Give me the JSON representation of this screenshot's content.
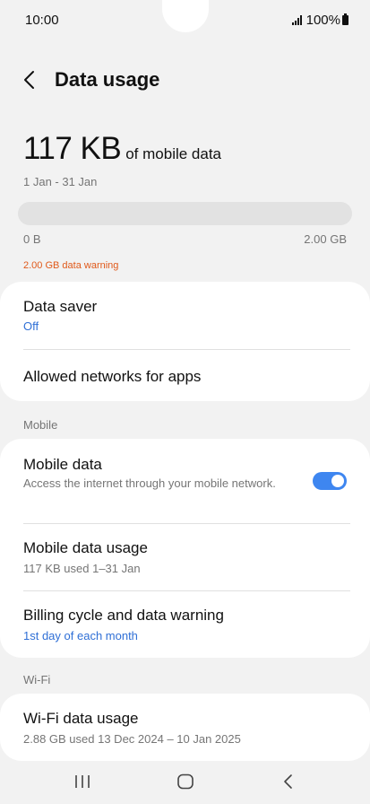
{
  "status_bar": {
    "time": "10:00",
    "battery": "100%"
  },
  "header": {
    "title": "Data usage"
  },
  "summary": {
    "amount": "117 KB",
    "suffix": "of mobile data",
    "period": "1 Jan - 31 Jan",
    "bar_min": "0 B",
    "bar_max": "2.00 GB",
    "bar_fill_fraction": 0.0,
    "warning": "2.00 GB data warning"
  },
  "general": {
    "data_saver_title": "Data saver",
    "data_saver_value": "Off",
    "allowed_networks_title": "Allowed networks for apps"
  },
  "mobile": {
    "section_label": "Mobile",
    "mobile_data_title": "Mobile data",
    "mobile_data_desc": "Access the internet through your mobile network.",
    "mobile_data_enabled": true,
    "usage_title": "Mobile data usage",
    "usage_sub": "117 KB used 1–31 Jan",
    "billing_title": "Billing cycle and data warning",
    "billing_sub": "1st day of each month"
  },
  "wifi": {
    "section_label": "Wi-Fi",
    "usage_title": "Wi-Fi data usage",
    "usage_sub": "2.88 GB used 13 Dec 2024 – 10 Jan 2025"
  },
  "colors": {
    "accent": "#3e86f0",
    "link_blue": "#2f6fd6",
    "warning": "#e0591a",
    "background": "#f2f2f2",
    "card": "#ffffff"
  },
  "icons": {
    "back": "chevron-left-icon",
    "signal": "signal-icon",
    "battery": "battery-icon",
    "nav_recents": "recents-icon",
    "nav_home": "home-icon",
    "nav_back": "back-icon"
  }
}
